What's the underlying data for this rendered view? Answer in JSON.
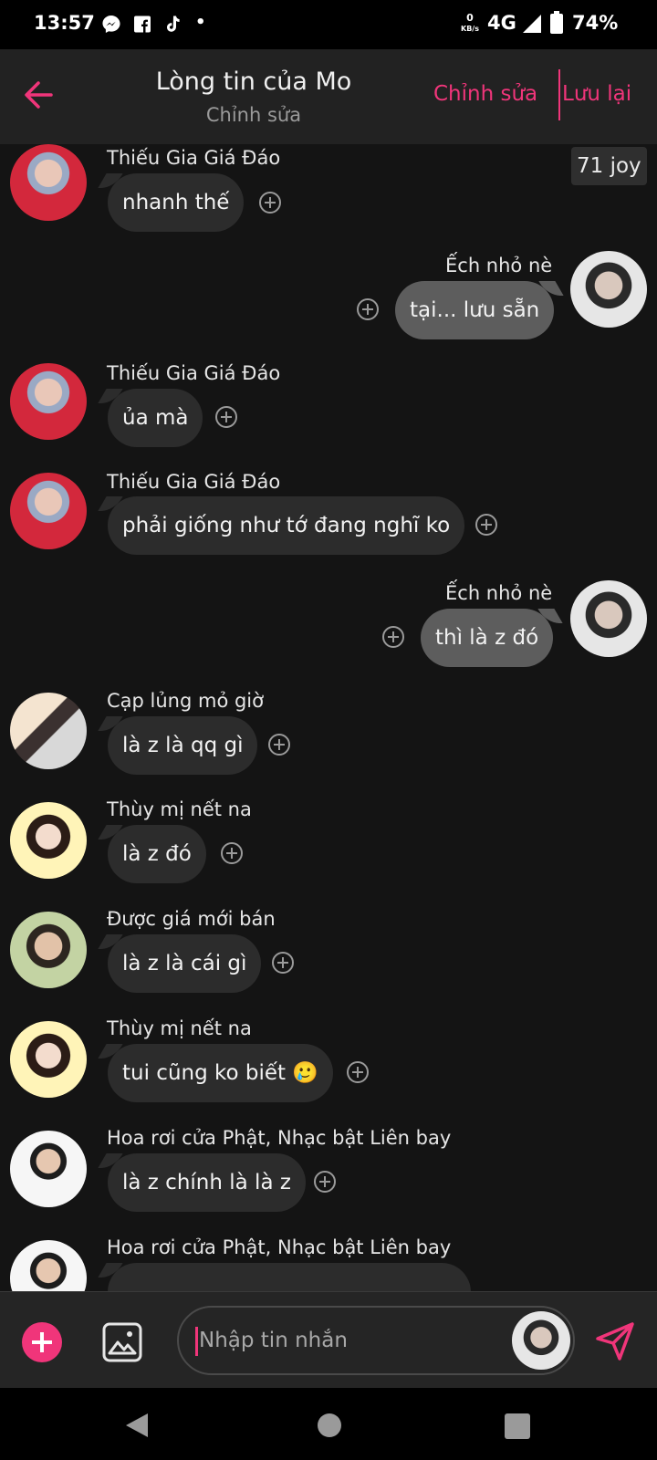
{
  "status_bar": {
    "time": "13:57",
    "network": "4G",
    "battery": "74%",
    "kbs": "0",
    "kbs_unit": "KB/s",
    "dot": "•"
  },
  "header": {
    "title": "Lòng tin của Mo",
    "subtitle": "Chỉnh sửa",
    "edit_label": "Chỉnh sửa",
    "save_label": "Lưu lại"
  },
  "joy_badge": "71 joy",
  "messages": [
    {
      "sender": "Thiếu Gia Giá Đáo",
      "text": "nhanh thế",
      "side": "left"
    },
    {
      "sender": "Ếch nhỏ nè",
      "text": "tại... lưu sẵn",
      "side": "right"
    },
    {
      "sender": "Thiếu Gia Giá Đáo",
      "text": "ủa mà",
      "side": "left"
    },
    {
      "sender": "Thiếu Gia Giá Đáo",
      "text": "phải giống như tớ đang nghĩ ko",
      "side": "left"
    },
    {
      "sender": "Ếch nhỏ nè",
      "text": "thì là z đó",
      "side": "right"
    },
    {
      "sender": "Cạp lủng mỏ giờ",
      "text": "là z là qq gì",
      "side": "left"
    },
    {
      "sender": "Thùy mị nết na",
      "text": "là z đó",
      "side": "left"
    },
    {
      "sender": "Được giá mới bán",
      "text": "là z là cái gì",
      "side": "left"
    },
    {
      "sender": "Thùy mị nết na",
      "text": "tui cũng ko biết 🥲",
      "side": "left"
    },
    {
      "sender": "Hoa rơi cửa Phật, Nhạc bật Liên bay",
      "text": "là z chính là là z",
      "side": "left"
    },
    {
      "sender": "Hoa rơi cửa Phật, Nhạc bật Liên bay",
      "text": "",
      "side": "left"
    }
  ],
  "composer": {
    "placeholder": "Nhập tin nhắn"
  },
  "colors": {
    "accent": "#f0357a",
    "background": "#141414",
    "header": "#222222",
    "bubble_left": "#2c2c2c",
    "bubble_right": "#5d5d5d"
  },
  "icons": [
    "back-arrow-icon",
    "add-icon",
    "image-icon",
    "send-icon",
    "messenger-icon",
    "facebook-icon",
    "tiktok-icon",
    "signal-icon",
    "battery-icon"
  ]
}
